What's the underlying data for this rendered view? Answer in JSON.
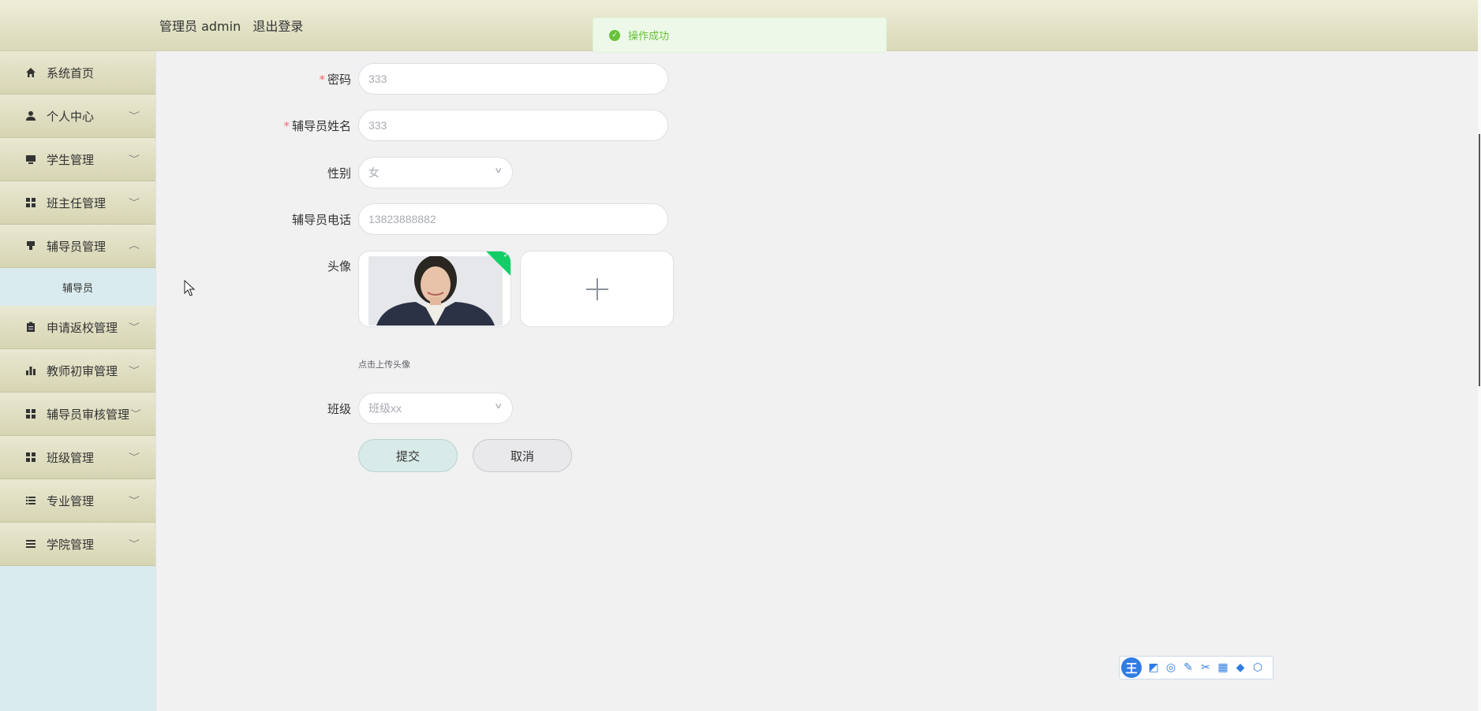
{
  "header": {
    "user_text": "管理员 admin",
    "logout_label": "退出登录"
  },
  "toast": {
    "message": "操作成功",
    "color": "#67c23a"
  },
  "sidebar": {
    "items": [
      {
        "label": "系统首页",
        "icon": "home-icon",
        "chevron": ""
      },
      {
        "label": "个人中心",
        "icon": "person-icon",
        "chevron": "﹀"
      },
      {
        "label": "学生管理",
        "icon": "monitor-icon",
        "chevron": "﹀"
      },
      {
        "label": "班主任管理",
        "icon": "grid-icon",
        "chevron": "﹀"
      },
      {
        "label": "辅导员管理",
        "icon": "cup-icon",
        "chevron": "︿"
      },
      {
        "label": "申请返校管理",
        "icon": "clipboard-icon",
        "chevron": "﹀"
      },
      {
        "label": "教师初审管理",
        "icon": "bar-chart-icon",
        "chevron": "﹀"
      },
      {
        "label": "辅导员审核管理",
        "icon": "grid-icon",
        "chevron": "﹀"
      },
      {
        "label": "班级管理",
        "icon": "grid-icon",
        "chevron": "﹀"
      },
      {
        "label": "专业管理",
        "icon": "list-icon",
        "chevron": "﹀"
      },
      {
        "label": "学院管理",
        "icon": "list-icon",
        "chevron": "﹀"
      }
    ],
    "sub_item": "辅导员"
  },
  "form": {
    "password": {
      "label": "密码",
      "value": "333"
    },
    "name": {
      "label": "辅导员姓名",
      "value": "333"
    },
    "gender": {
      "label": "性别",
      "value": "女"
    },
    "phone": {
      "label": "辅导员电话",
      "value": "13823888882"
    },
    "avatar": {
      "label": "头像",
      "hint": "点击上传头像"
    },
    "class": {
      "label": "班级",
      "value": "班级xx"
    },
    "submit_label": "提交",
    "cancel_label": "取消"
  },
  "ime": {
    "logo_text": "王"
  }
}
